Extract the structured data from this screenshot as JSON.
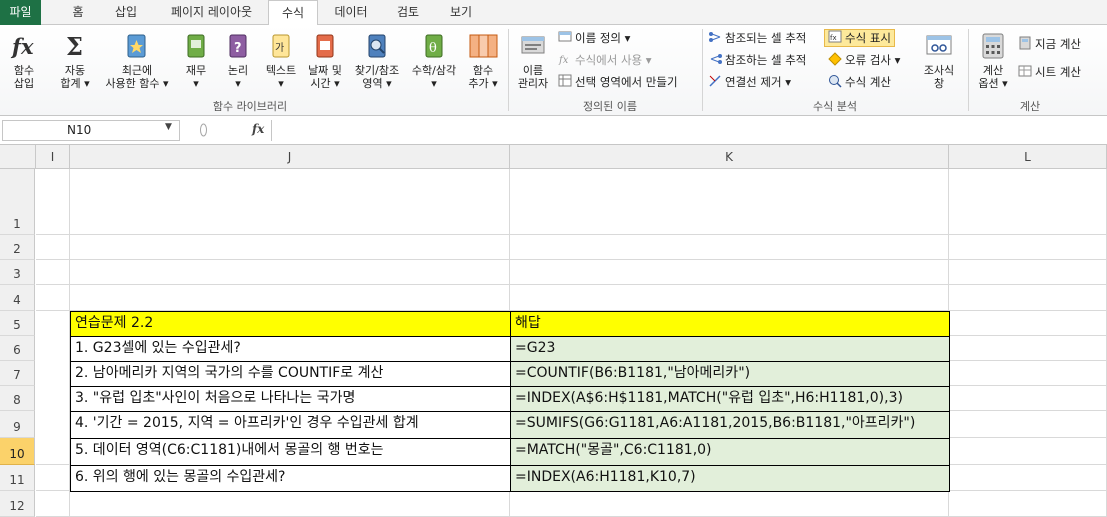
{
  "tabs": [
    {
      "label": "파일",
      "kind": "file"
    },
    {
      "label": "홈"
    },
    {
      "label": "삽입"
    },
    {
      "label": "페이지 레이아웃"
    },
    {
      "label": "수식",
      "active": true
    },
    {
      "label": "데이터"
    },
    {
      "label": "검토"
    },
    {
      "label": "보기"
    }
  ],
  "ribbon": {
    "function_library": {
      "insert_function": "함수\n삽입",
      "autosum": "자동\n합계 ▾",
      "recent": "최근에\n사용한 함수 ▾",
      "financial": "재무\n▾",
      "logical": "논리\n▾",
      "text": "텍스트\n▾",
      "datetime": "날짜 및\n시간 ▾",
      "lookup": "찾기/참조\n영역 ▾",
      "math": "수학/삼각\n▾",
      "more": "함수\n추가 ▾",
      "group_label": "함수 라이브러리"
    },
    "defined_names": {
      "name_manager": "이름\n관리자",
      "define_name": "이름 정의 ▾",
      "use_in_formula": "수식에서 사용 ▾",
      "create_from_selection": "선택 영역에서 만들기",
      "group_label": "정의된 이름"
    },
    "formula_auditing": {
      "trace_precedents": "참조되는 셀 추적",
      "trace_dependents": "참조하는 셀 추적",
      "remove_arrows": "연결선 제거 ▾",
      "show_formulas": "수식 표시",
      "error_checking": "오류 검사 ▾",
      "evaluate_formula": "수식 계산",
      "watch_window": "조사식\n창",
      "group_label": "수식 분석"
    },
    "calculation": {
      "calc_options": "계산\n옵션 ▾",
      "calc_now": "지금 계산",
      "calc_sheet": "시트 계산",
      "group_label": "계산"
    }
  },
  "formula_bar": {
    "name_box": "N10",
    "fx": "fx",
    "formula": ""
  },
  "columns": [
    "I",
    "J",
    "K",
    "L"
  ],
  "rows": [
    "1",
    "2",
    "3",
    "4",
    "5",
    "6",
    "7",
    "8",
    "9",
    "10",
    "11",
    "12"
  ],
  "selected_row": "10",
  "table": {
    "header": {
      "question": "연습문제 2.2",
      "answer": "해답"
    },
    "items": [
      {
        "question": "1. G23셀에 있는 수입관세?",
        "answer": "=G23"
      },
      {
        "question": "2. 남아메리카 지역의 국가의 수를 COUNTIF로 계산",
        "answer": "=COUNTIF(B6:B1181,\"남아메리카\")"
      },
      {
        "question": "3. \"유럽 입초\"사인이 처음으로 나타나는 국가명",
        "answer": "=INDEX(A$6:H$1181,MATCH(\"유럽 입초\",H6:H1181,0),3)"
      },
      {
        "question": "4. '기간 = 2015, 지역 = 아프리카'인 경우 수입관세 합계",
        "answer": "=SUMIFS(G6:G1181,A6:A1181,2015,B6:B1181,\"아프리카\")"
      },
      {
        "question": "5. 데이터 영역(C6:C1181)내에서 몽골의 행 번호는",
        "answer": "=MATCH(\"몽골\",C6:C1181,0)"
      },
      {
        "question": "6. 위의 행에 있는 몽골의 수입관세?",
        "answer": "=INDEX(A6:H1181,K10,7)"
      }
    ]
  },
  "colors": {
    "file_tab": "#1e7145",
    "header_fill": "#ffff00",
    "answer_fill": "#e2efda",
    "selected_row_header": "#fbd26a",
    "show_formulas_highlight": "#fde99b"
  }
}
